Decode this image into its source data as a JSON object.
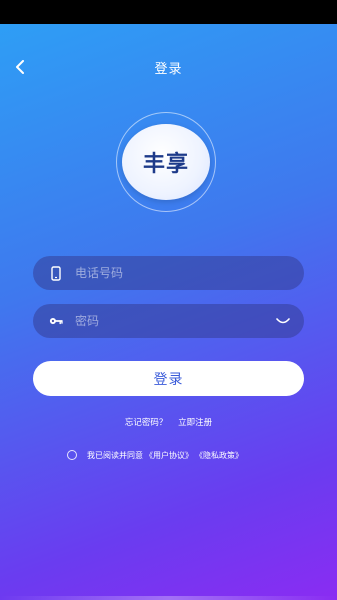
{
  "header": {
    "title": "登录",
    "back_icon": "chevron-left-icon"
  },
  "logo": {
    "text": "丰享"
  },
  "phone_field": {
    "placeholder": "电话号码",
    "icon": "phone-icon"
  },
  "password_field": {
    "placeholder": "密码",
    "icon": "key-icon",
    "toggle_icon": "eye-closed-icon"
  },
  "login_button": {
    "label": "登录"
  },
  "links": {
    "forgot_password": "忘记密码？",
    "register": "立即注册"
  },
  "agreement": {
    "prefix": "我已阅读并同意",
    "user_agreement": "《用户协议》",
    "privacy_policy": "《隐私政策》"
  },
  "colors": {
    "gradient_start": "#2e9ef5",
    "gradient_end": "#8a2cf2",
    "button_text": "#3a5bd9",
    "logo_text": "#1d3a8a"
  }
}
